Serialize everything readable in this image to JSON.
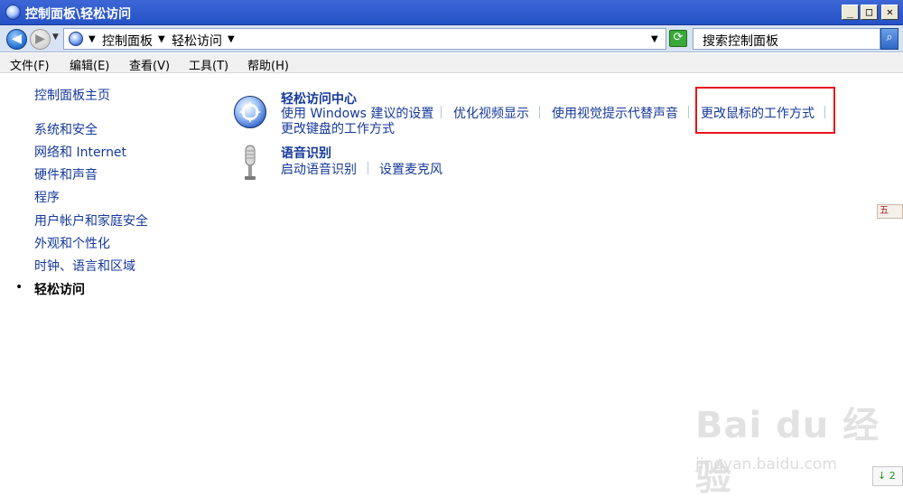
{
  "window": {
    "title": "控制面板\\轻松访问",
    "minimize": "_",
    "maximize": "□",
    "close": "✕"
  },
  "address": {
    "crumbs": [
      "控制面板",
      "轻松访问"
    ],
    "search_placeholder": "搜索控制面板"
  },
  "menu": [
    "文件(F)",
    "编辑(E)",
    "查看(V)",
    "工具(T)",
    "帮助(H)"
  ],
  "sidebar": {
    "home": "控制面板主页",
    "items": [
      "系统和安全",
      "网络和 Internet",
      "硬件和声音",
      "程序",
      "用户帐户和家庭安全",
      "外观和个性化",
      "时钟、语言和区域"
    ],
    "current": "轻松访问"
  },
  "categories": [
    {
      "title": "轻松访问中心",
      "icon": "ease-of-access-icon",
      "links": [
        "使用 Windows 建议的设置",
        "优化视频显示",
        "使用视觉提示代替声音",
        "更改鼠标的工作方式",
        "更改键盘的工作方式"
      ]
    },
    {
      "title": "语音识别",
      "icon": "microphone-icon",
      "links": [
        "启动语音识别",
        "设置麦克风"
      ]
    }
  ],
  "side_widget": "五",
  "bottom_widget": "↓ 2",
  "watermark": {
    "logo": "Bai du 经验",
    "url": "jingyan.baidu.com"
  },
  "colors": {
    "link": "#15399a",
    "highlight": "#e8141a",
    "titlebar": "#2452c6"
  }
}
